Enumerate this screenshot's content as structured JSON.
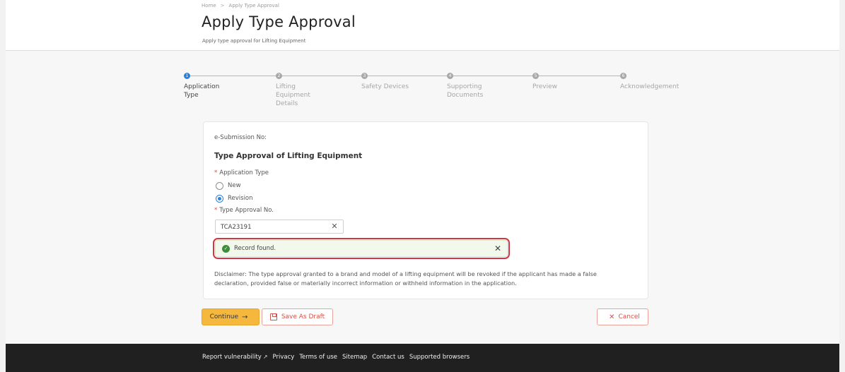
{
  "header": {
    "breadcrumb": [
      "Home",
      "Apply Type Approval"
    ],
    "breadcrumb_sep": ">",
    "title": "Apply Type Approval",
    "subtitle": "Apply type approval for Lifting Equipment"
  },
  "stepper": {
    "steps": [
      {
        "num": "1",
        "label": "Application Type",
        "active": true
      },
      {
        "num": "2",
        "label": "Lifting Equipment Details",
        "active": false
      },
      {
        "num": "3",
        "label": "Safety Devices",
        "active": false
      },
      {
        "num": "4",
        "label": "Supporting Documents",
        "active": false
      },
      {
        "num": "5",
        "label": "Preview",
        "active": false
      },
      {
        "num": "6",
        "label": "Acknowledgement",
        "active": false
      }
    ]
  },
  "form": {
    "esubmission_label": "e-Submission No:",
    "section_title": "Type Approval of Lifting Equipment",
    "required_mark": "*",
    "application_type_label": "Application Type",
    "options": [
      {
        "label": "New",
        "checked": false
      },
      {
        "label": "Revision",
        "checked": true
      }
    ],
    "type_approval_no_label": "Type Approval No.",
    "type_approval_no_value": "TCA23191",
    "alert_message": "Record found.",
    "disclaimer": "Disclaimer: The type approval granted to a brand and model of a lifting equipment will be revoked if the applicant has made a false declaration, provided false or materially incorrect information or withheld information in the application."
  },
  "actions": {
    "continue_label": "Continue",
    "save_draft_label": "Save As Draft",
    "cancel_label": "Cancel"
  },
  "footer": {
    "links": [
      "Report vulnerability",
      "Privacy",
      "Terms of use",
      "Sitemap",
      "Contact us",
      "Supported browsers"
    ]
  },
  "colors": {
    "accent": "#2f80d8",
    "continue": "#f5b83d",
    "danger": "#d43545",
    "success": "#3a8f3a"
  }
}
